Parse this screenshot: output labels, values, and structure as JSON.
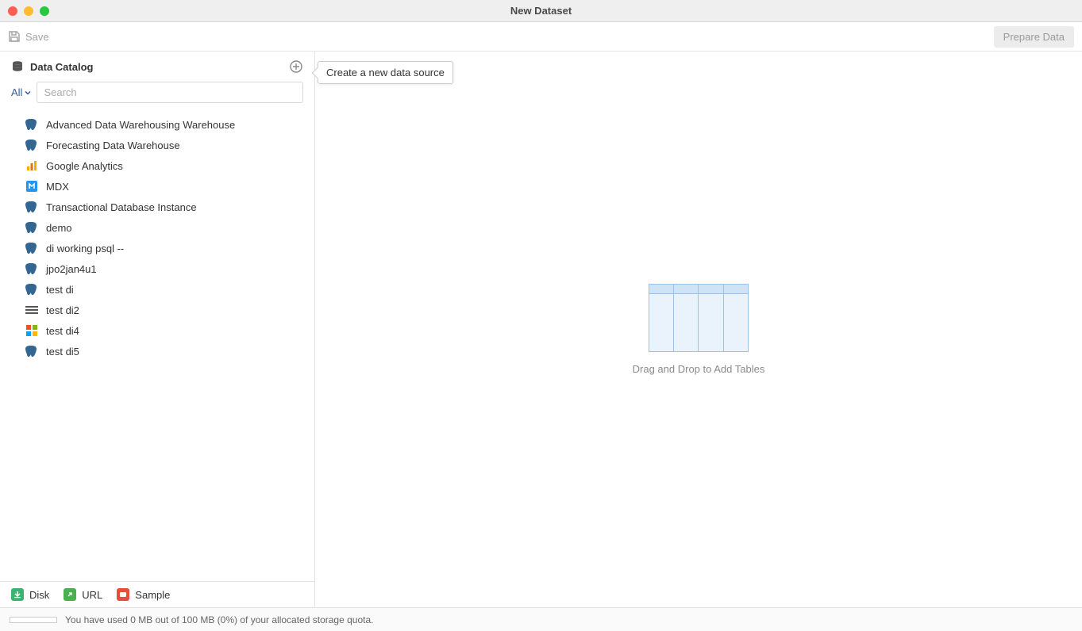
{
  "window": {
    "title": "New Dataset"
  },
  "toolbar": {
    "save_label": "Save",
    "prepare_label": "Prepare Data"
  },
  "sidebar": {
    "title": "Data Catalog",
    "filter_label": "All",
    "search_placeholder": "Search",
    "items": [
      {
        "label": "Advanced Data Warehousing Warehouse",
        "icon": "postgres"
      },
      {
        "label": "Forecasting Data Warehouse",
        "icon": "postgres"
      },
      {
        "label": "Google Analytics",
        "icon": "ga"
      },
      {
        "label": "MDX",
        "icon": "mdx"
      },
      {
        "label": "Transactional Database Instance",
        "icon": "postgres"
      },
      {
        "label": "demo",
        "icon": "postgres"
      },
      {
        "label": "di working psql --",
        "icon": "postgres"
      },
      {
        "label": "jpo2jan4u1",
        "icon": "postgres"
      },
      {
        "label": "test di",
        "icon": "postgres"
      },
      {
        "label": "test di2",
        "icon": "ibm"
      },
      {
        "label": "test di4",
        "icon": "ms"
      },
      {
        "label": "test di5",
        "icon": "postgres"
      }
    ],
    "footer": {
      "disk": "Disk",
      "url": "URL",
      "sample": "Sample"
    }
  },
  "canvas": {
    "drop_hint": "Drag and Drop to Add Tables"
  },
  "tooltip": {
    "text": "Create a new data source"
  },
  "status": {
    "quota_text": "You have used 0 MB out of 100 MB (0%) of your allocated storage quota."
  }
}
